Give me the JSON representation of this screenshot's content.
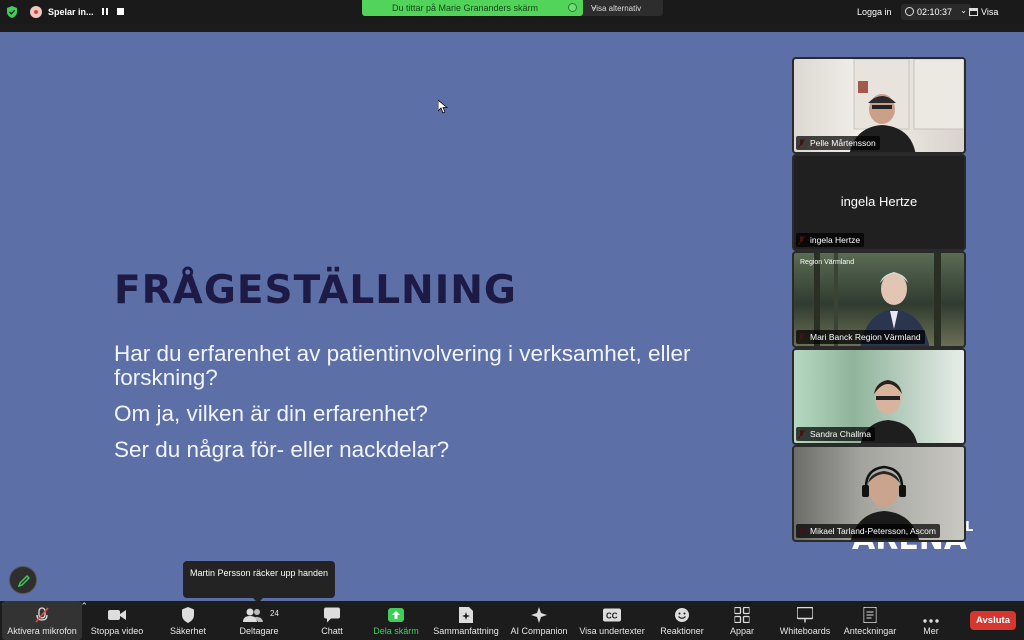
{
  "topbar": {
    "recording_label": "Spelar in...",
    "viewing_text": "Du tittar på Marie Grananders skärm",
    "view_options": "Visa alternativ",
    "login": "Logga in",
    "timer": "02:10:37",
    "view": "Visa"
  },
  "slide": {
    "title": "FRÅGESTÄLLNING",
    "q1": "Har du erfarenhet av patientinvolvering i verksamhet, eller forskning?",
    "q2": "Om ja, vilken är din erfarenhet?",
    "q3": "Ser du några för- eller nackdelar?",
    "logo": "ARENA",
    "logo_small": "L"
  },
  "participants": [
    {
      "name": "Pelle Mårtensson"
    },
    {
      "name": "ingela Hertze",
      "display": "ingela Hertze"
    },
    {
      "name": "Mari Banck Region Värmland",
      "overlay": "Region Värmland"
    },
    {
      "name": "Sandra Challma"
    },
    {
      "name": "Mikael Tarland-Petersson, Ascom"
    }
  ],
  "notification": "Martin Persson räcker upp handen",
  "toolbar": {
    "mic": "Aktivera mikrofon",
    "video": "Stoppa video",
    "security": "Säkerhet",
    "participants": "Deltagare",
    "participants_count": "24",
    "chat": "Chatt",
    "share": "Dela skärm",
    "summary": "Sammanfattning",
    "ai": "AI Companion",
    "captions": "Visa undertexter",
    "reactions": "Reaktioner",
    "apps": "Appar",
    "whiteboards": "Whiteboards",
    "notes": "Anteckningar",
    "more": "Mer",
    "end": "Avsluta"
  },
  "colors": {
    "slide_bg": "#5c6fa6",
    "title": "#1e1a46",
    "share_green": "#52d45a",
    "end_red": "#d63630"
  }
}
